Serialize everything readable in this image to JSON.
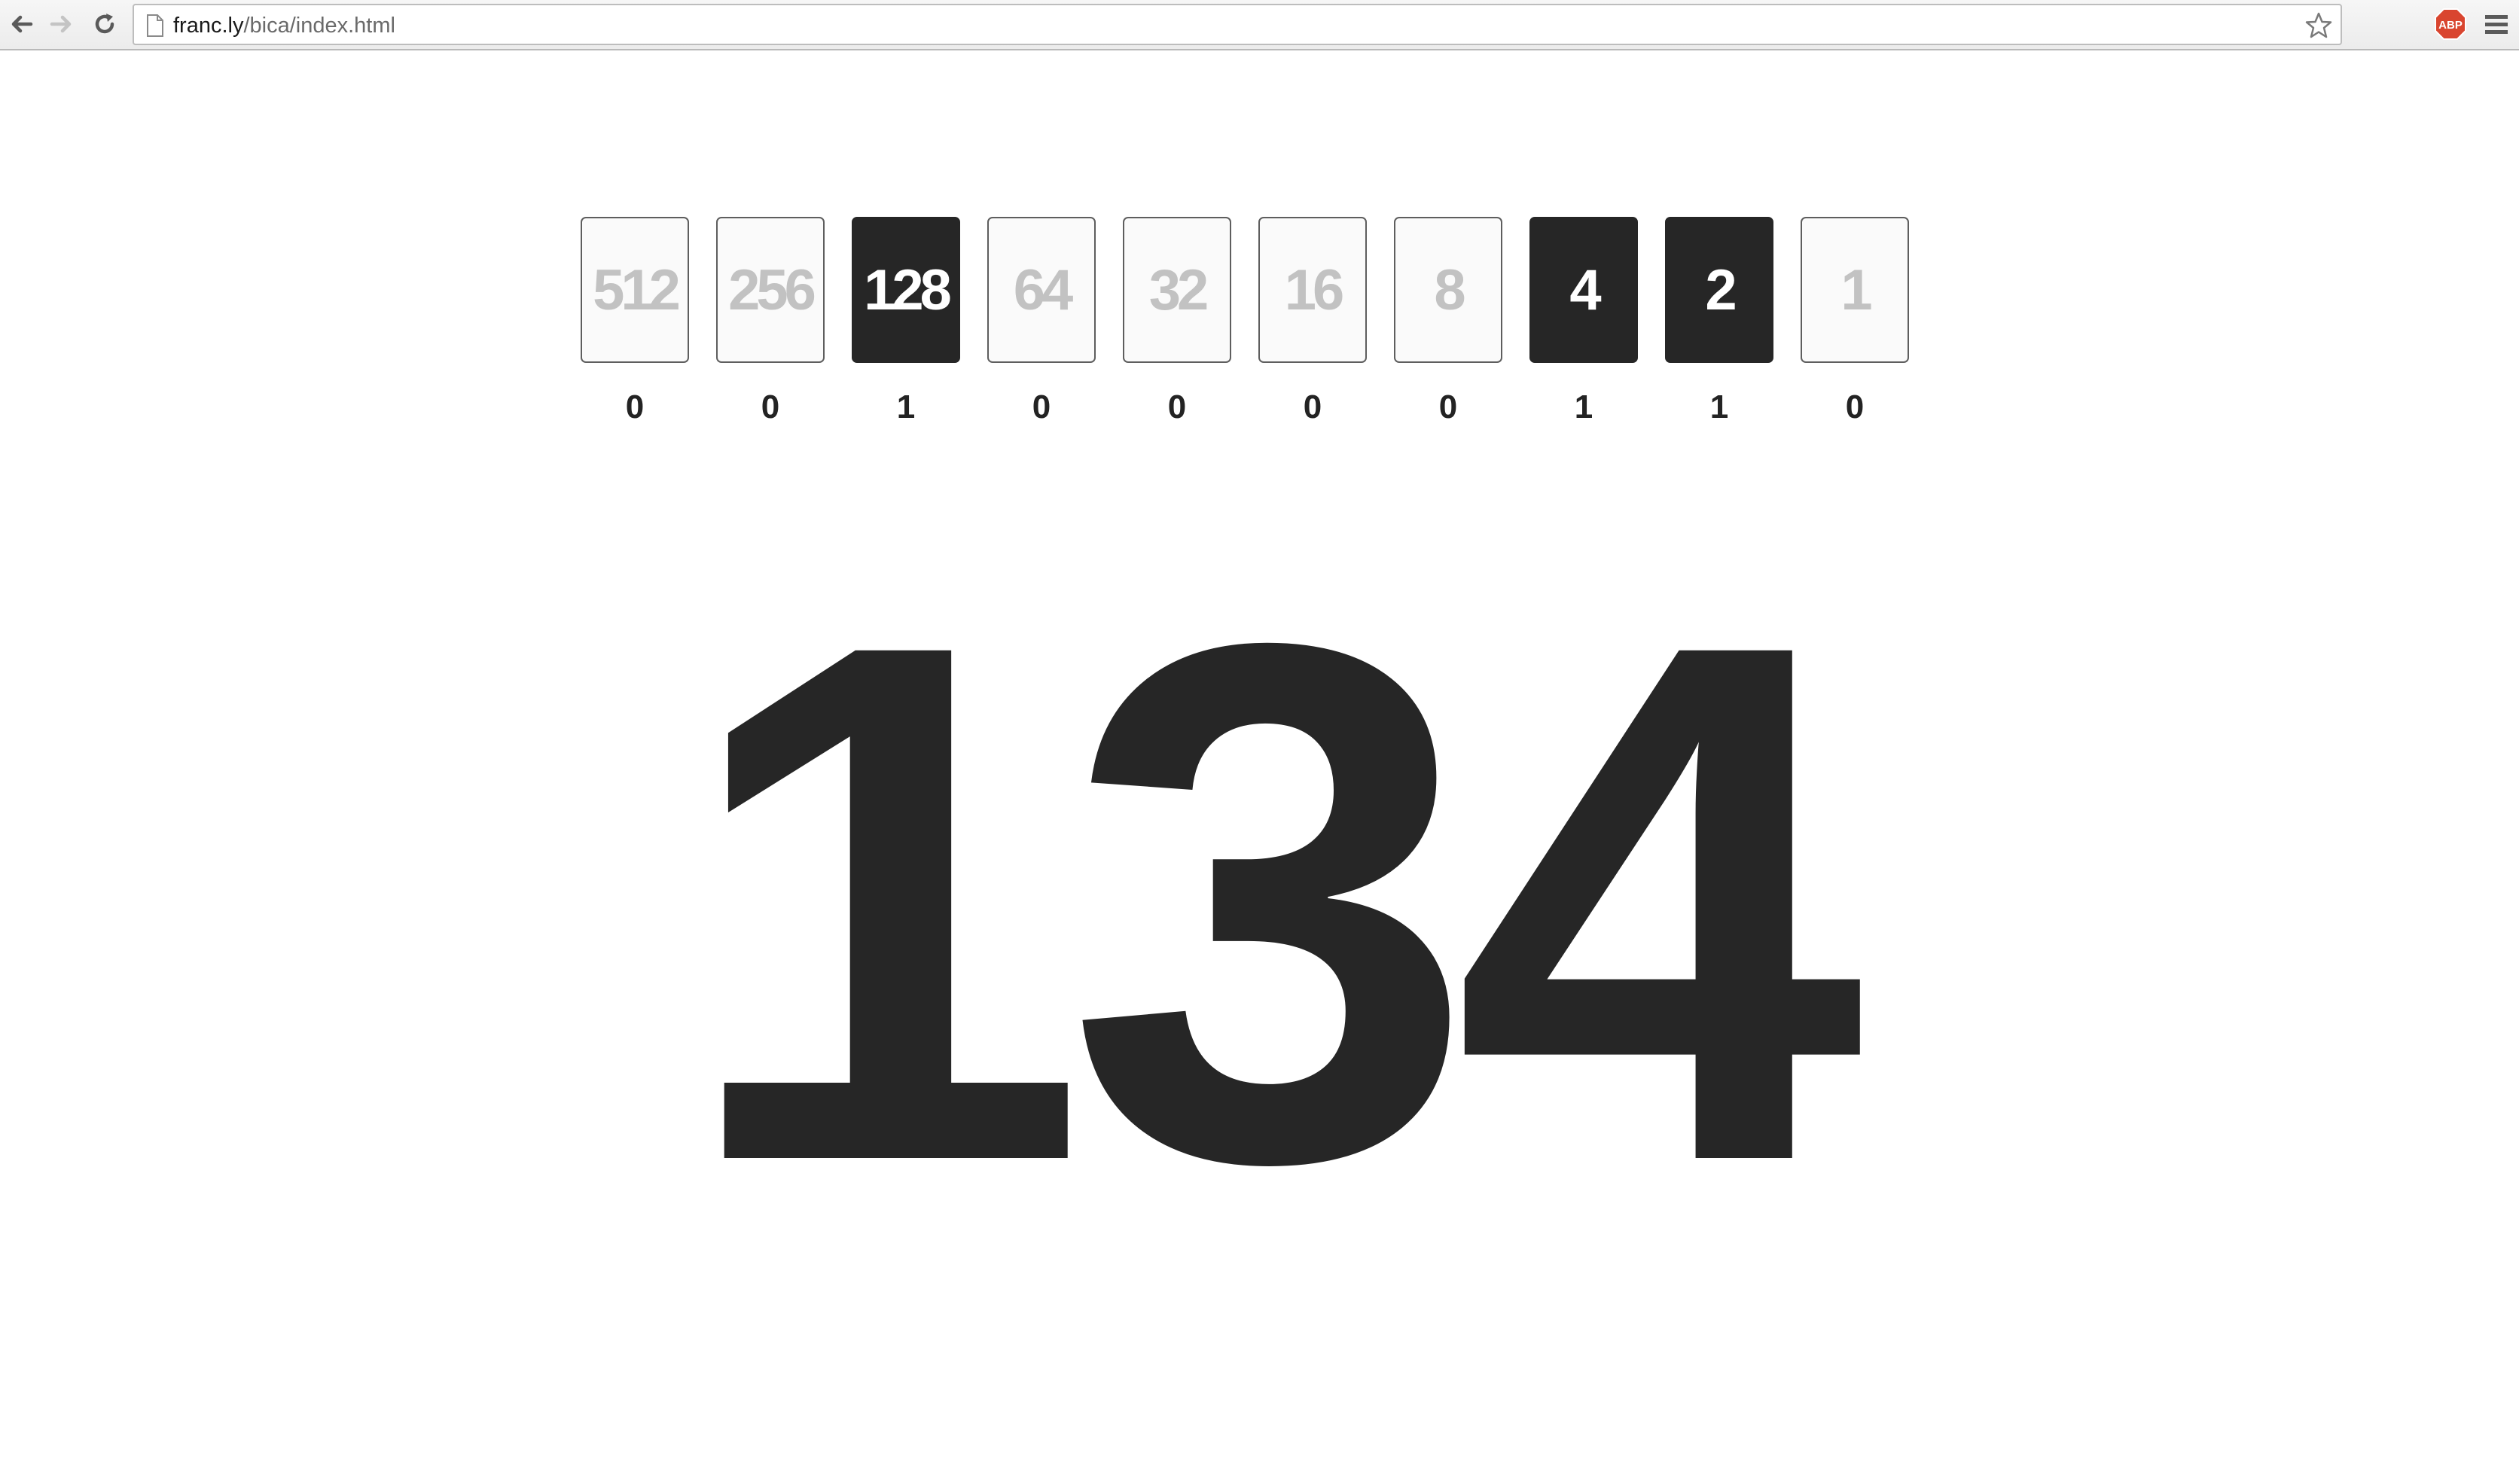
{
  "browser": {
    "url_domain": "franc.ly",
    "url_path": "/bica/index.html",
    "extension_badge": "ABP"
  },
  "cards": [
    {
      "value": "512",
      "bit": "0",
      "on": false
    },
    {
      "value": "256",
      "bit": "0",
      "on": false
    },
    {
      "value": "128",
      "bit": "1",
      "on": true
    },
    {
      "value": "64",
      "bit": "0",
      "on": false
    },
    {
      "value": "32",
      "bit": "0",
      "on": false
    },
    {
      "value": "16",
      "bit": "0",
      "on": false
    },
    {
      "value": "8",
      "bit": "0",
      "on": false
    },
    {
      "value": "4",
      "bit": "1",
      "on": true
    },
    {
      "value": "2",
      "bit": "1",
      "on": true
    },
    {
      "value": "1",
      "bit": "0",
      "on": false
    }
  ],
  "decimal_value": "134",
  "colors": {
    "card_on_bg": "#262626",
    "card_off_bg": "#fafafa",
    "card_off_text": "#c2c2c2",
    "abp_red": "#d9452f"
  },
  "icons": {
    "back": "back-arrow-icon",
    "forward": "forward-arrow-icon",
    "reload": "reload-icon",
    "page": "page-icon",
    "bookmark": "star-icon",
    "adblock": "adblock-plus-icon",
    "menu": "hamburger-menu-icon"
  }
}
